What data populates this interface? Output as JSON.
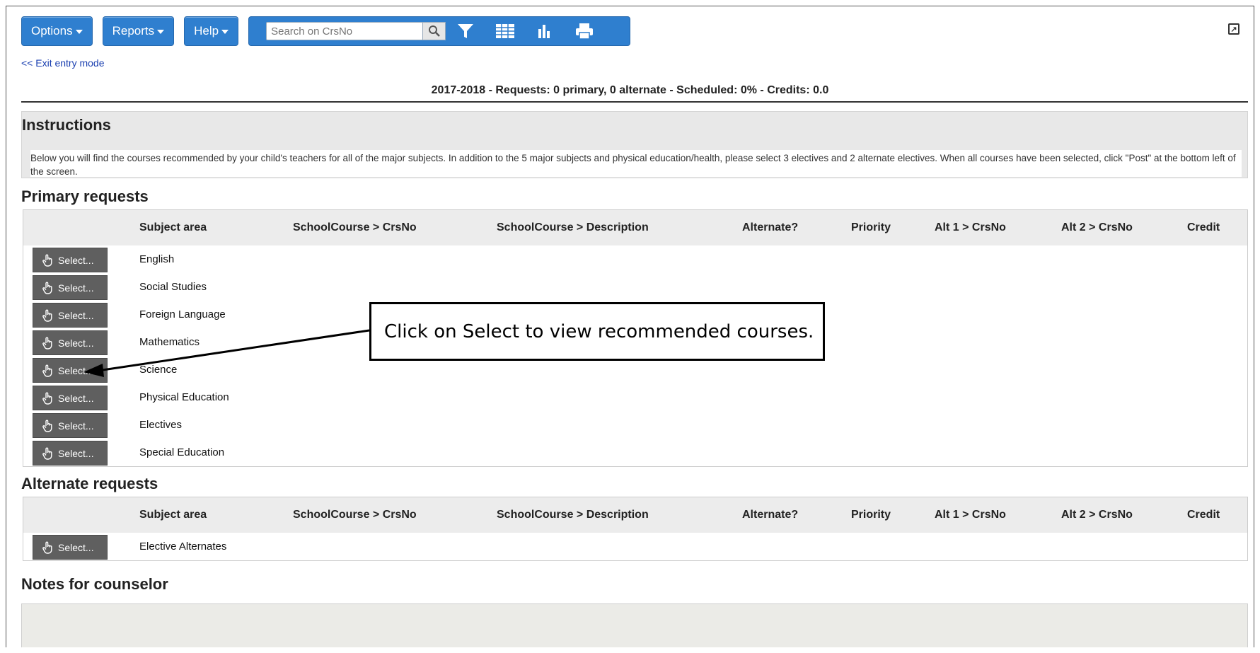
{
  "toolbar": {
    "options_label": "Options",
    "reports_label": "Reports",
    "help_label": "Help",
    "search_placeholder": "Search on CrsNo",
    "icons": [
      "search-icon",
      "filter-icon",
      "grid-icon",
      "chart-icon",
      "print-icon"
    ]
  },
  "exit_link": "<< Exit entry mode",
  "summary": "2017-2018 - Requests: 0 primary, 0 alternate - Scheduled: 0% - Credits: 0.0",
  "instructions": {
    "title": "Instructions",
    "text": "Below you will find the courses recommended by your child's teachers for all of the major subjects. In addition to the 5 major subjects and physical education/health, please select 3 electives and 2 alternate electives. When all courses have been selected, click \"Post\" at the bottom left of the screen."
  },
  "columns": [
    "Subject area",
    "SchoolCourse > CrsNo",
    "SchoolCourse > Description",
    "Alternate?",
    "Priority",
    "Alt 1 > CrsNo",
    "Alt 2 > CrsNo",
    "Credit"
  ],
  "primary": {
    "title": "Primary requests",
    "select_label": "Select...",
    "rows": [
      "English",
      "Social Studies",
      "Foreign Language",
      "Mathematics",
      "Science",
      "Physical Education",
      "Electives",
      "Special Education"
    ]
  },
  "alternate": {
    "title": "Alternate requests",
    "select_label": "Select...",
    "rows": [
      "Elective Alternates"
    ]
  },
  "notes": {
    "title": "Notes for counselor"
  },
  "callout": {
    "text": "Click on Select to view recommended courses."
  }
}
